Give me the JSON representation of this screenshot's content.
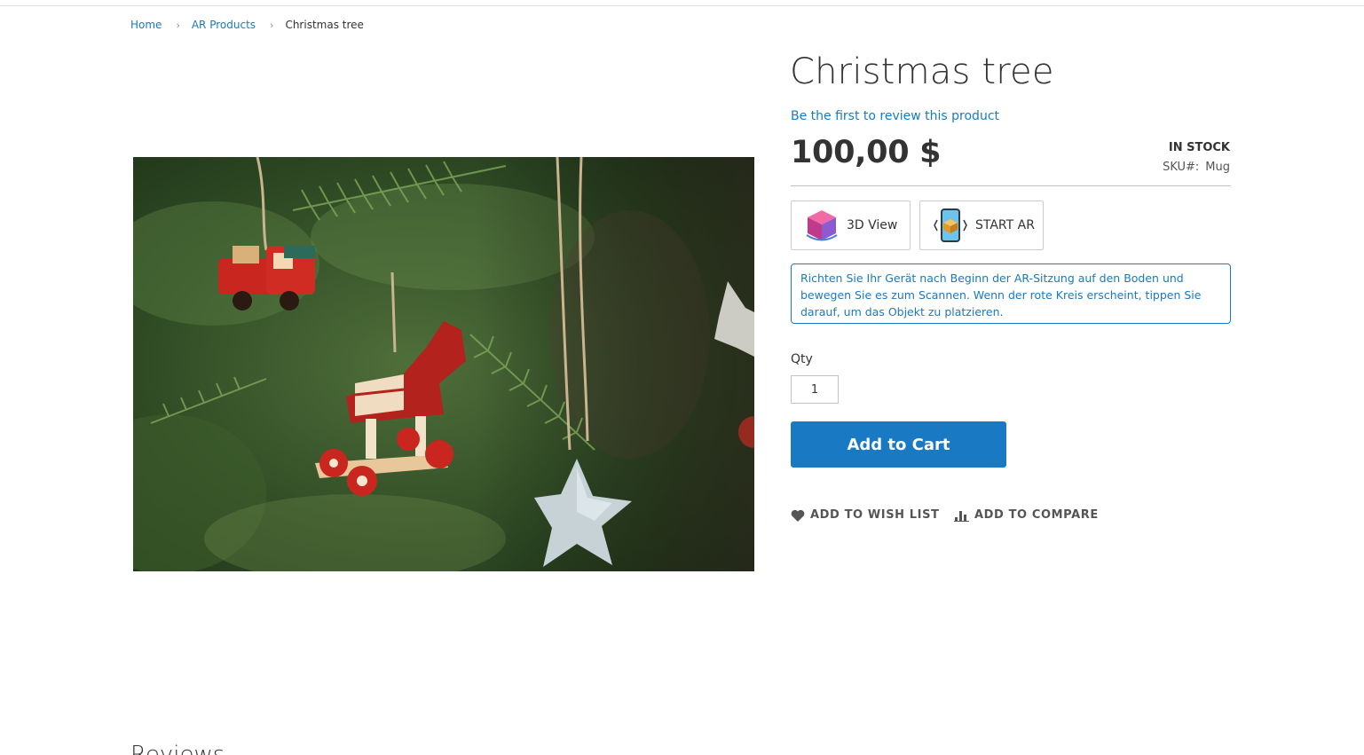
{
  "breadcrumb": {
    "items": [
      "Home",
      "AR Products"
    ],
    "current": "Christmas tree"
  },
  "product": {
    "title": "Christmas tree",
    "review_link": "Be the first to review this product",
    "price": "100,00 $",
    "stock": "IN STOCK",
    "sku_label": "SKU#:",
    "sku_value": "Mug",
    "image_icon": "christmas-ornaments-photo"
  },
  "ar": {
    "view3d_label": "3D View",
    "view3d_icon": "cube-3d-icon",
    "start_ar_label": "START AR",
    "start_ar_icon": "phone-ar-icon",
    "hint": "Richten Sie Ihr Gerät nach Beginn der AR-Sitzung auf den Boden und bewegen Sie es zum Scannen. Wenn der rote Kreis erscheint, tippen Sie darauf, um das Objekt zu platzieren."
  },
  "cart": {
    "qty_label": "Qty",
    "qty_value": "1",
    "add_label": "Add to Cart"
  },
  "actions": {
    "wish_label": "ADD TO WISH LIST",
    "wish_icon": "heart-icon",
    "compare_label": "ADD TO COMPARE",
    "compare_icon": "bar-chart-icon"
  },
  "reviews": {
    "title": "Reviews"
  },
  "colors": {
    "link": "#1979c3",
    "primary_button": "#1979c3",
    "text": "#333333"
  }
}
